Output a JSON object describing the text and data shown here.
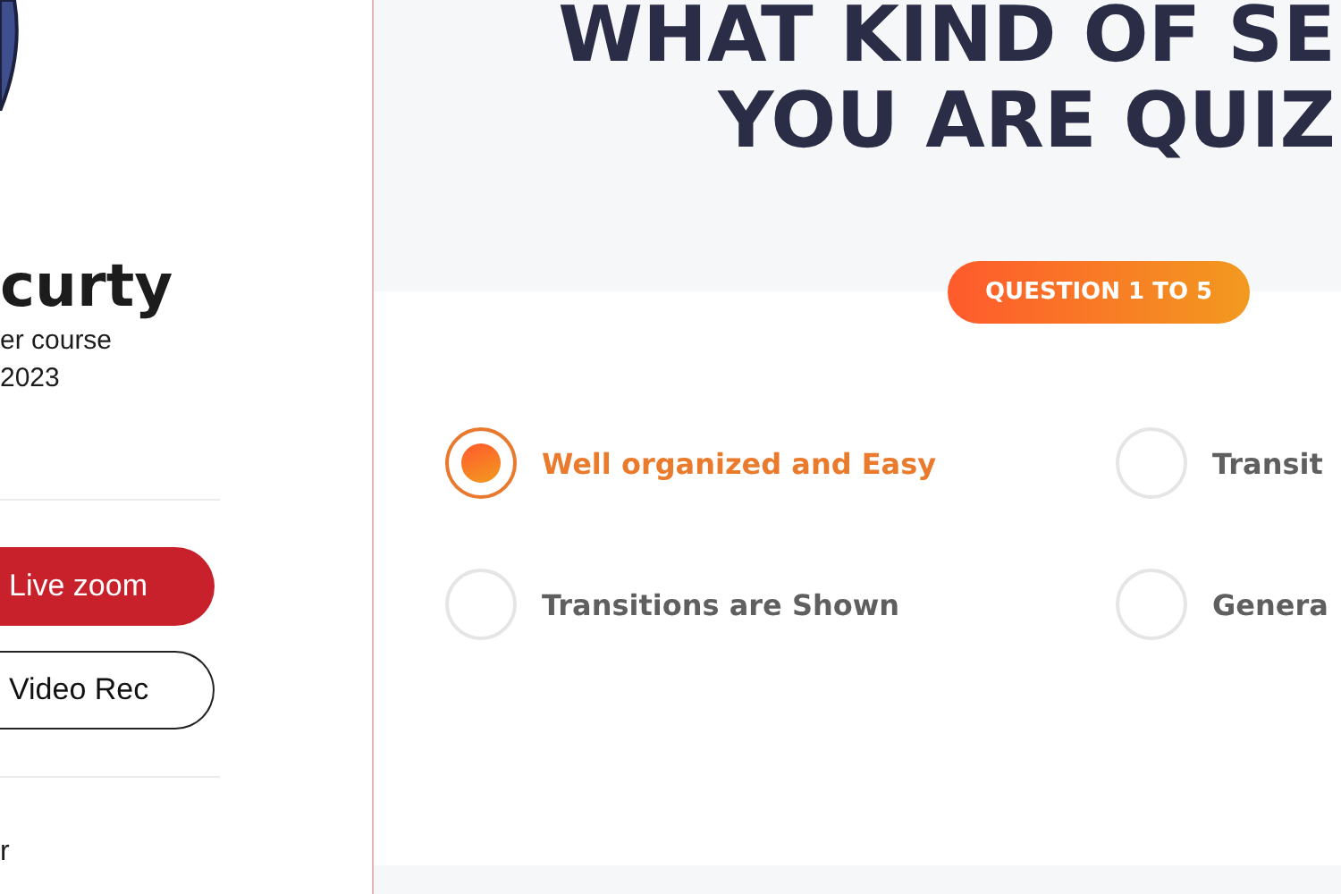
{
  "sidebar": {
    "course_title": "curty",
    "course_subtitle": "er course",
    "course_year": "2023",
    "buttons": [
      {
        "label": "Live zoom",
        "kind": "filled"
      },
      {
        "label": "Video Rec",
        "kind": "outline"
      }
    ],
    "footer_text": "r"
  },
  "quiz": {
    "title_lines": [
      "WHAT KIND OF SE",
      "YOU ARE QUIZ"
    ],
    "progress_badge": "QUESTION 1 TO 5",
    "options": [
      {
        "label": "Well organized and Easy",
        "selected": true
      },
      {
        "label": "Transit",
        "selected": false
      },
      {
        "label": "Transitions are Shown",
        "selected": false
      },
      {
        "label": "Genera",
        "selected": false
      }
    ]
  }
}
